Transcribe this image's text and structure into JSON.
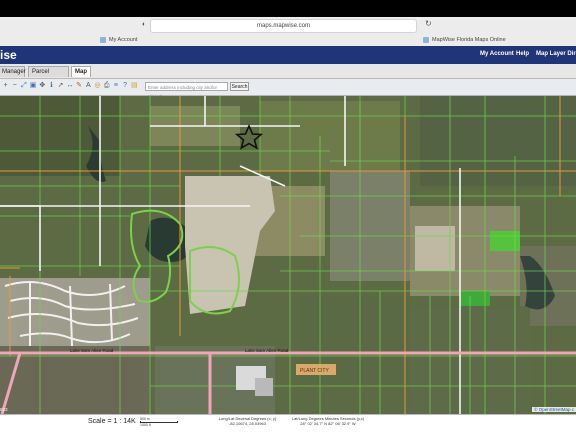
{
  "browser": {
    "url": "maps.mapwise.com",
    "tabs": [
      {
        "label": "My Account"
      },
      {
        "label": "MapWise Florida Maps Online"
      }
    ]
  },
  "app": {
    "logo_text": "ise",
    "nav": [
      "My Account",
      "Help",
      "Map Layer Directo"
    ]
  },
  "tabs": [
    {
      "label": "Manager"
    },
    {
      "label": "Parcel Details"
    },
    {
      "label": "Map",
      "active": true
    }
  ],
  "toolbar": {
    "search_placeholder": "Enter address including city and/or zipcode",
    "search_button": "Search",
    "tool_icons": [
      "zoom-in-icon",
      "zoom-out-icon",
      "zoom-extent-icon",
      "zoom-box-icon",
      "pan-icon",
      "identify-icon",
      "select-icon",
      "measure-icon",
      "draw-icon",
      "label-icon",
      "buffer-icon",
      "print-icon",
      "layers-icon",
      "help-icon",
      "notes-icon"
    ]
  },
  "map": {
    "road_labels": [
      "Lake Sam Allen Road",
      "Lake Sam Allen Road"
    ],
    "place_label": "PLANT CITY",
    "marker": "star",
    "attribution": "© OpenStreetMap c"
  },
  "status": {
    "scale": "Scale = 1 : 14K",
    "scalebar_top": "500 m",
    "scalebar_bottom": "1000 ft",
    "latlon_title": "Long/Lat Decimal Degrees (x, y)",
    "latlon_value": "-82.10674, 28.03963",
    "dms_title": "Lat/Long Degrees Minutes Seconds (y,x)",
    "dms_value": "28° 02' 34.7\" N 82° 06' 32.9\" W",
    "corner_number": "823"
  }
}
